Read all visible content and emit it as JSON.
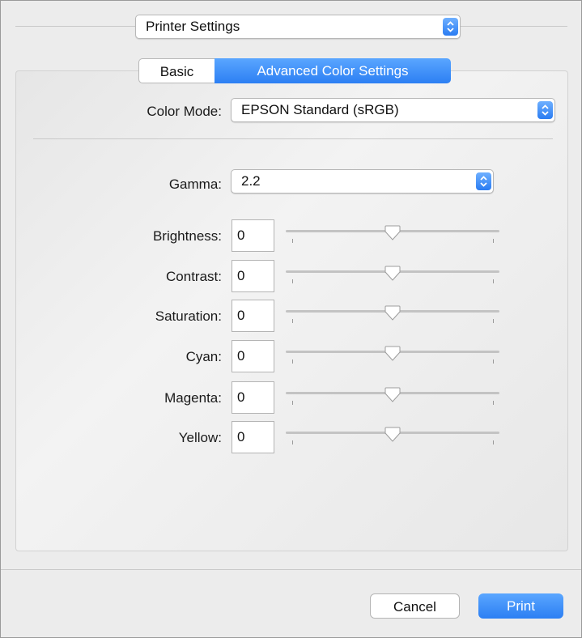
{
  "dialog": {
    "settings_popup": "Printer Settings",
    "tabs": [
      {
        "label": "Basic",
        "selected": false
      },
      {
        "label": "Advanced Color Settings",
        "selected": true
      }
    ],
    "color_mode": {
      "label": "Color Mode:",
      "value": "EPSON Standard (sRGB)"
    },
    "gamma": {
      "label": "Gamma:",
      "value": "2.2"
    },
    "adjustments": [
      {
        "label": "Brightness:",
        "value": "0",
        "slider_level": 0.5
      },
      {
        "label": "Contrast:",
        "value": "0",
        "slider_level": 0.5
      },
      {
        "label": "Saturation:",
        "value": "0",
        "slider_level": 0.5
      },
      {
        "label": "Cyan:",
        "value": "0",
        "slider_level": 0.5
      },
      {
        "label": "Magenta:",
        "value": "0",
        "slider_level": 0.5
      },
      {
        "label": "Yellow:",
        "value": "0",
        "slider_level": 0.5
      }
    ],
    "buttons": {
      "cancel": "Cancel",
      "print": "Print"
    },
    "colors": {
      "accent": "#2c7ff3",
      "background": "#ececec"
    }
  }
}
